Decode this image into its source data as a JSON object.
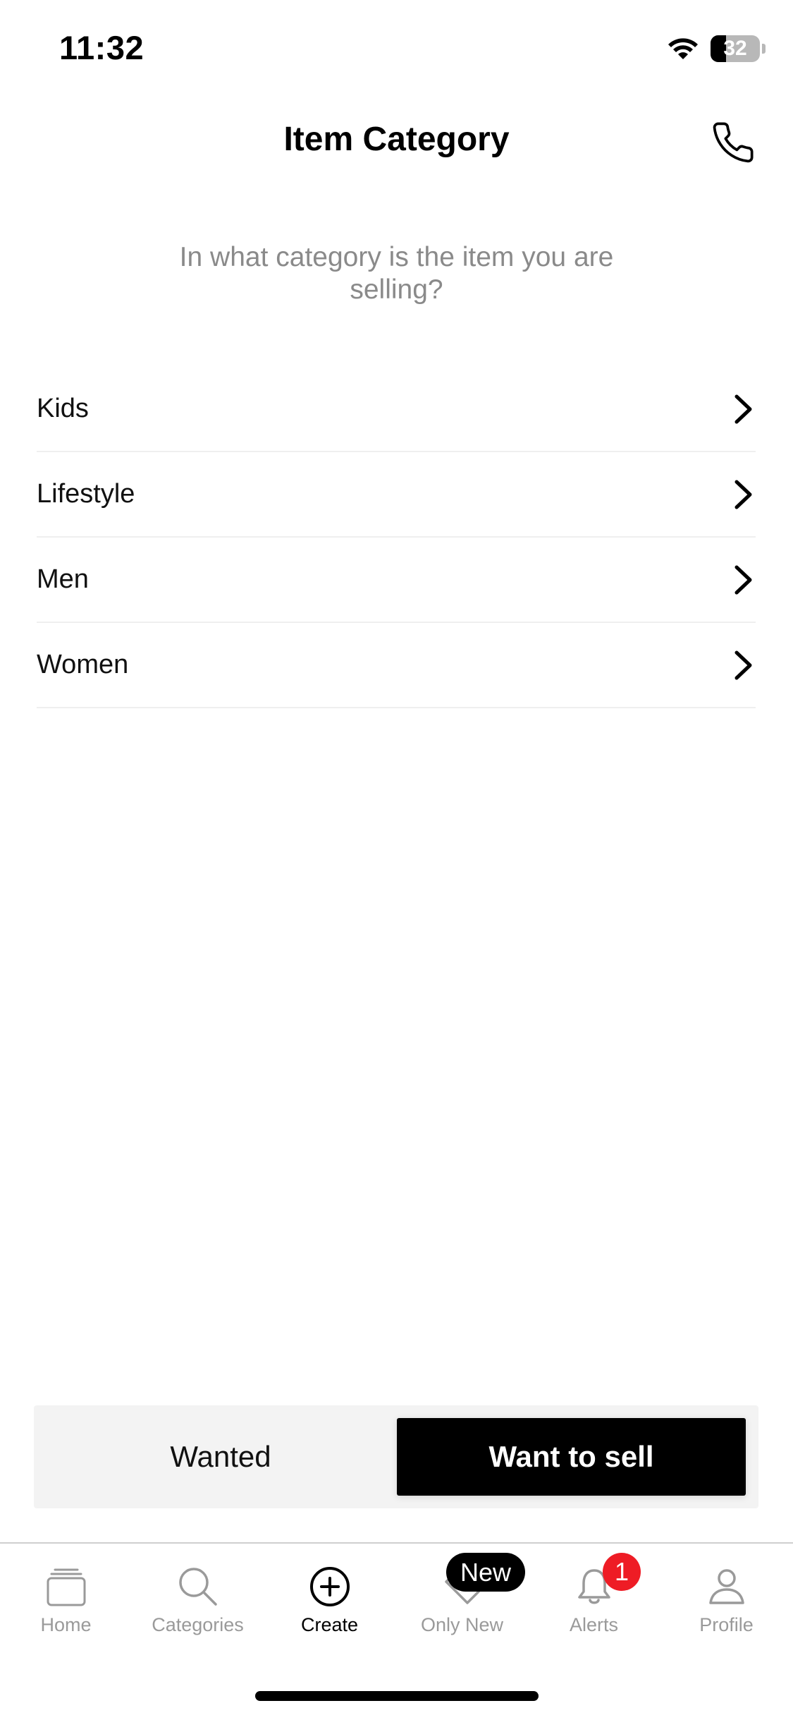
{
  "status_bar": {
    "time": "11:32",
    "battery_level": "32",
    "battery_fraction": 0.32
  },
  "header": {
    "title": "Item Category",
    "call_icon": "phone-icon"
  },
  "prompt": "In what category is the item you are selling?",
  "categories": [
    {
      "label": "Kids"
    },
    {
      "label": "Lifestyle"
    },
    {
      "label": "Men"
    },
    {
      "label": "Women"
    }
  ],
  "listing_type": {
    "options": [
      "Wanted",
      "Want to sell"
    ],
    "selected": "Want to sell"
  },
  "tab_bar": {
    "active": "Create",
    "tabs": [
      {
        "label": "Home",
        "icon": "cards-stack-icon"
      },
      {
        "label": "Categories",
        "icon": "search-icon"
      },
      {
        "label": "Create",
        "icon": "plus-circle-icon"
      },
      {
        "label": "Only New",
        "icon": "tag-icon",
        "badge": "New"
      },
      {
        "label": "Alerts",
        "icon": "bell-icon",
        "badge": "1"
      },
      {
        "label": "Profile",
        "icon": "person-icon"
      }
    ]
  },
  "colors": {
    "accent": "#000000",
    "muted_text": "#8a8a8a",
    "alert_badge": "#ee1c25",
    "segment_background": "#f3f3f3"
  }
}
